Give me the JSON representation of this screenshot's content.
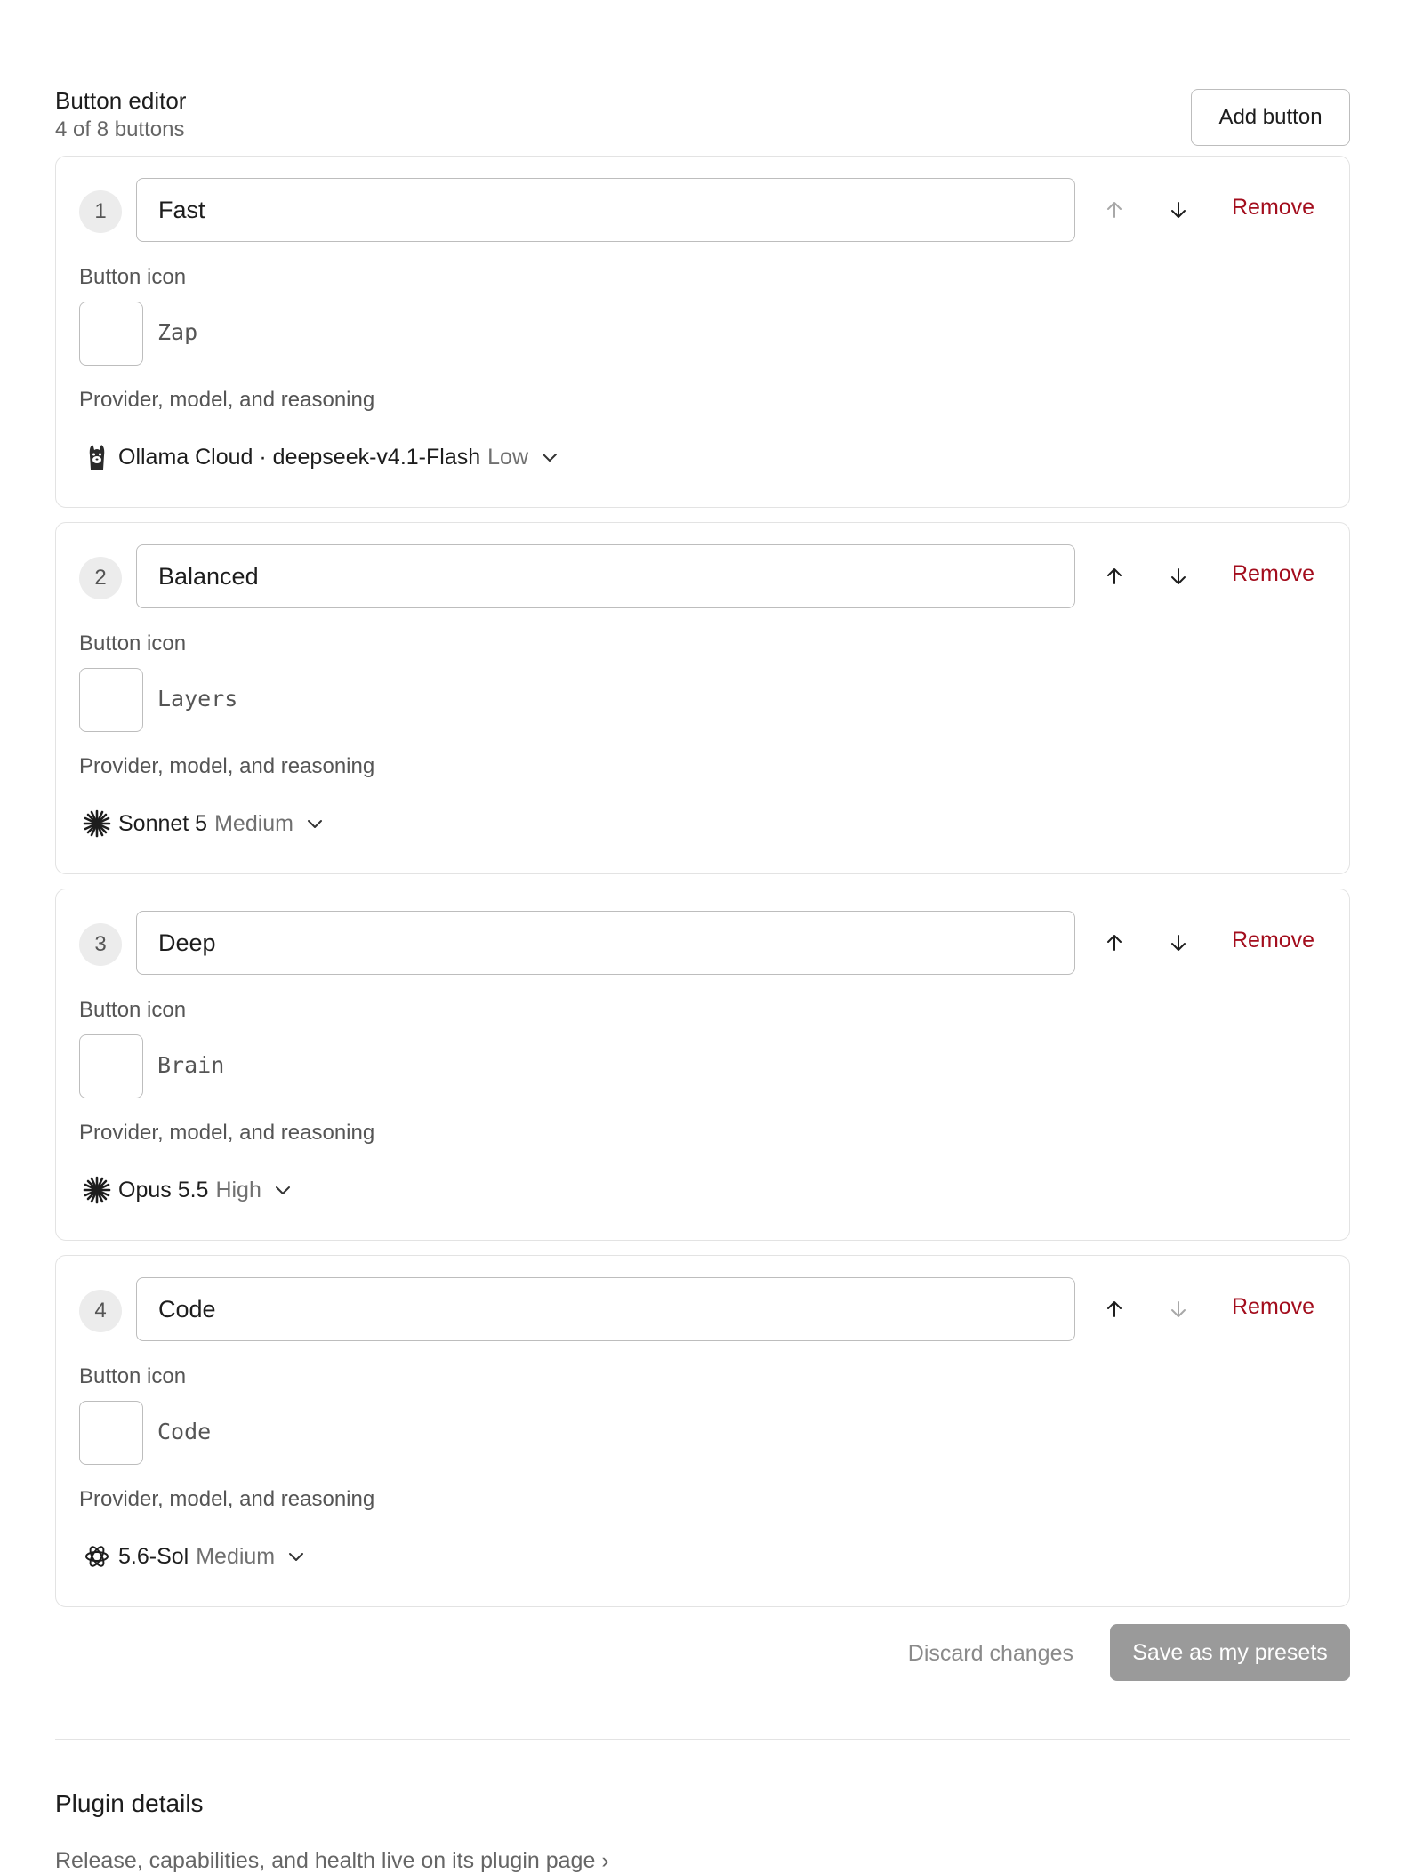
{
  "editor": {
    "title": "Button editor",
    "count": "4 of 8 buttons",
    "add_label": "Add button"
  },
  "labels": {
    "icon": "Button icon",
    "model": "Provider, model, and reasoning",
    "remove": "Remove"
  },
  "buttons": [
    {
      "index": "1",
      "name": "Fast",
      "icon": "Zap",
      "model": "Ollama Cloud · deepseek-v4.1-Flash",
      "effort": "Low",
      "logo": "ollama-icon"
    },
    {
      "index": "2",
      "name": "Balanced",
      "icon": "Layers",
      "model": "Sonnet 5",
      "effort": "Medium",
      "logo": "anthropic-icon"
    },
    {
      "index": "3",
      "name": "Deep",
      "icon": "Brain",
      "model": "Opus 5.5",
      "effort": "High",
      "logo": "anthropic-icon"
    },
    {
      "index": "4",
      "name": "Code",
      "icon": "Code",
      "model": "5.6-Sol",
      "effort": "Medium",
      "logo": "openai-icon"
    }
  ],
  "actions": {
    "discard_label": "Discard changes",
    "save_label": "Save as my presets"
  },
  "plugin": {
    "title": "Plugin details",
    "link": "Release, capabilities, and health live on its plugin page"
  },
  "colors": {
    "remove": "#a30d1d",
    "save_disabled": "#9a9a9a"
  }
}
